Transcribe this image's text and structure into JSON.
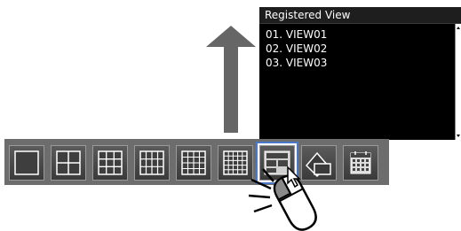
{
  "panel": {
    "title": "Registered View",
    "items": [
      "01. VIEW01",
      "02. VIEW02",
      "03. VIEW03"
    ]
  },
  "toolbar": {
    "buttons": [
      {
        "icon": "single-view-icon"
      },
      {
        "icon": "quad-view-icon"
      },
      {
        "icon": "nine-view-icon"
      },
      {
        "icon": "twelve-view-icon"
      },
      {
        "icon": "sixteen-view-icon"
      },
      {
        "icon": "twenty-five-view-icon"
      },
      {
        "icon": "registered-view-icon",
        "selected": true
      },
      {
        "icon": "rotate-view-icon"
      },
      {
        "icon": "calendar-icon"
      }
    ]
  },
  "colors": {
    "accent": "#4a78c8",
    "panel_bg": "#000000",
    "toolbar_bg": "#6d6d6d"
  }
}
